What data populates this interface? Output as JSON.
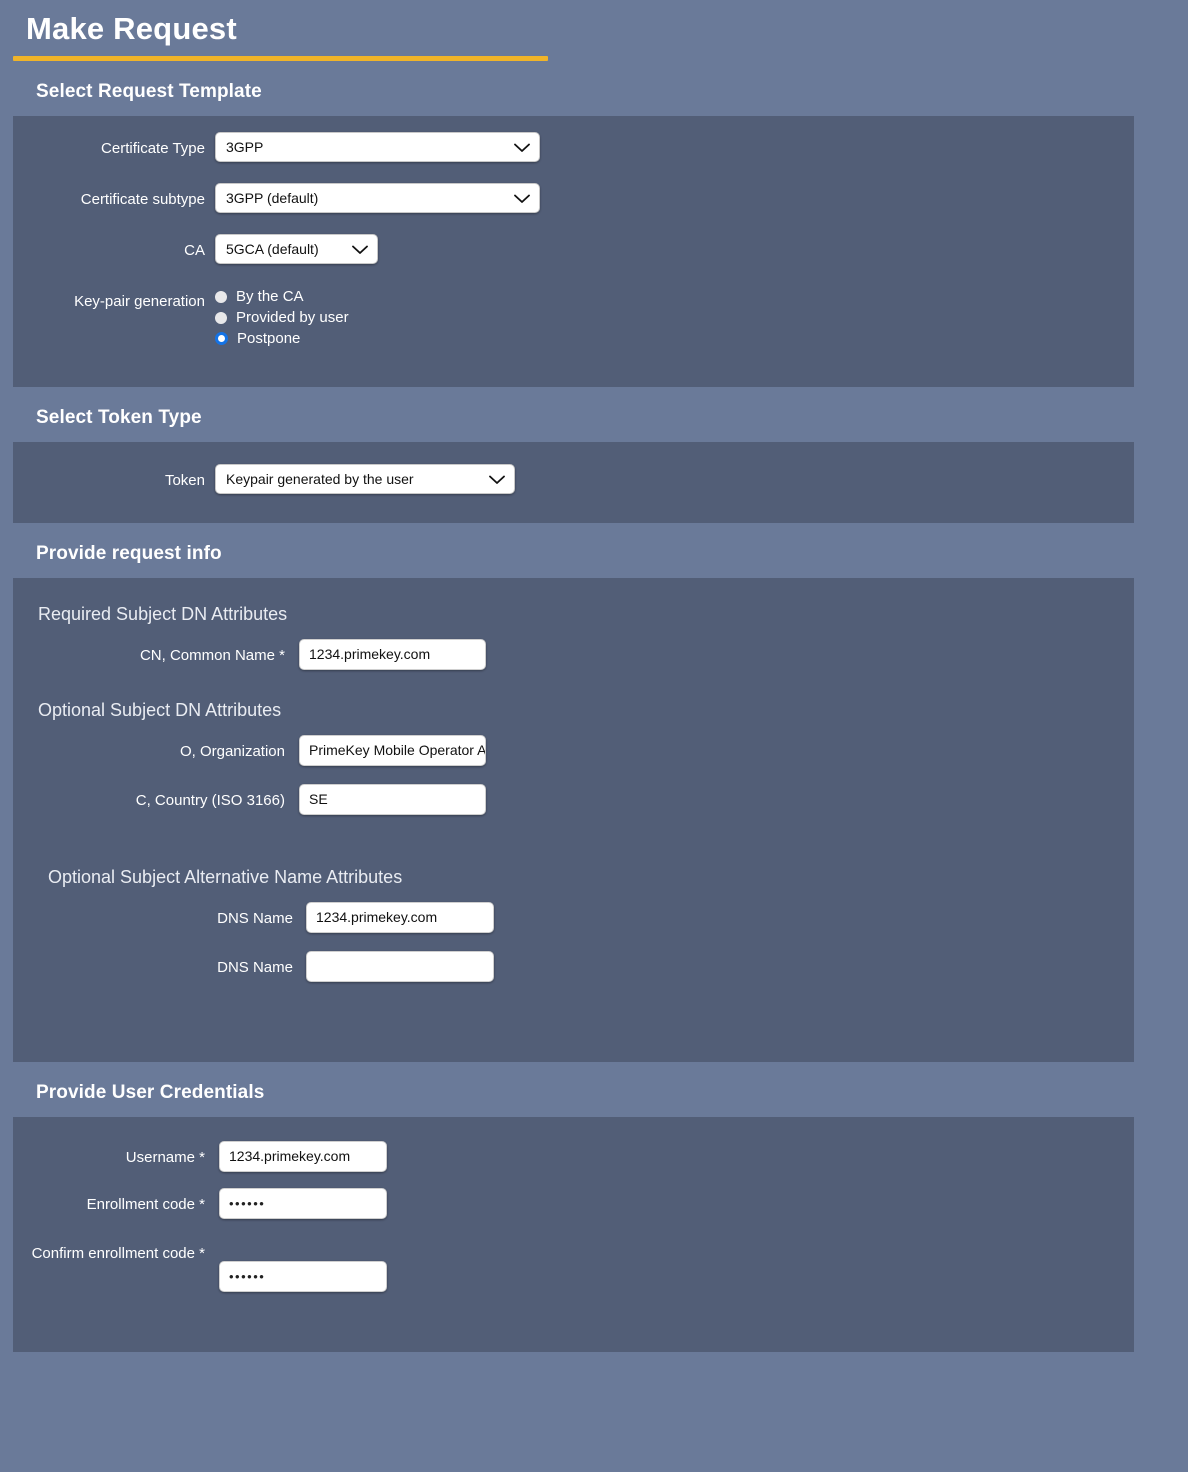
{
  "header": {
    "title": "Make Request"
  },
  "sections": {
    "template": {
      "heading": "Select Request Template",
      "certificate_type": {
        "label": "Certificate Type",
        "value": "3GPP"
      },
      "certificate_subtype": {
        "label": "Certificate subtype",
        "value": "3GPP (default)"
      },
      "ca": {
        "label": "CA",
        "value": "5GCA (default)"
      },
      "keypair": {
        "label": "Key-pair generation",
        "options": [
          {
            "label": "By the CA",
            "selected": false
          },
          {
            "label": "Provided by user",
            "selected": false
          },
          {
            "label": "Postpone",
            "selected": true
          }
        ]
      }
    },
    "token": {
      "heading": "Select Token Type",
      "token": {
        "label": "Token",
        "value": "Keypair generated by the user"
      }
    },
    "request_info": {
      "heading": "Provide request info",
      "required_dn_heading": "Required Subject DN Attributes",
      "common_name": {
        "label": "CN, Common Name *",
        "value": "1234.primekey.com"
      },
      "optional_dn_heading": "Optional Subject DN Attributes",
      "organization": {
        "label": "O, Organization",
        "value": "PrimeKey Mobile Operator AB"
      },
      "country": {
        "label": "C, Country (ISO 3166)",
        "value": "SE"
      },
      "optional_san_heading": "Optional Subject Alternative Name Attributes",
      "dns_name_1": {
        "label": "DNS Name",
        "value": "1234.primekey.com"
      },
      "dns_name_2": {
        "label": "DNS Name",
        "value": ""
      }
    },
    "credentials": {
      "heading": "Provide User Credentials",
      "username": {
        "label": "Username *",
        "value": "1234.primekey.com"
      },
      "enrollment_code": {
        "label": "Enrollment code *",
        "value": "••••••"
      },
      "confirm_enrollment_code": {
        "label": "Confirm enrollment code *",
        "value": "••••••"
      }
    }
  },
  "colors": {
    "page_background": "#6a7a99",
    "panel_background": "#525e77",
    "accent_rule": "#f0b429",
    "radio_selected": "#1473e6",
    "text_primary": "#ffffff"
  }
}
